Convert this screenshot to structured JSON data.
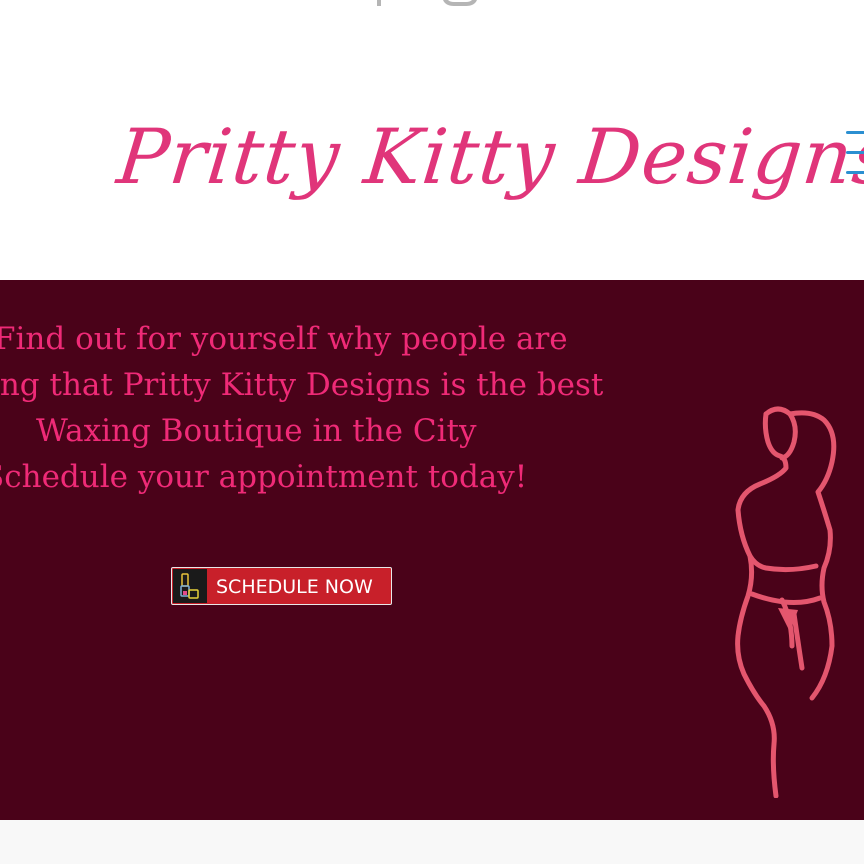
{
  "header": {
    "social": [
      {
        "name": "facebook-icon"
      },
      {
        "name": "instagram-icon"
      }
    ],
    "logo_text": "Pritty Kitty Designs",
    "menu_icon": "hamburger-menu-icon",
    "colors": {
      "logo": "#e0357a",
      "menu": "#2b8fd1"
    }
  },
  "hero": {
    "lines": [
      "Find out for yourself why people are",
      "saying that Pritty Kitty Designs is the best",
      "Waxing Boutique in the City",
      "Schedule your appointment today!"
    ],
    "cta_label": "SCHEDULE NOW",
    "colors": {
      "background": "#4a0219",
      "text": "#ef2a77",
      "button": "#c8202a"
    }
  }
}
